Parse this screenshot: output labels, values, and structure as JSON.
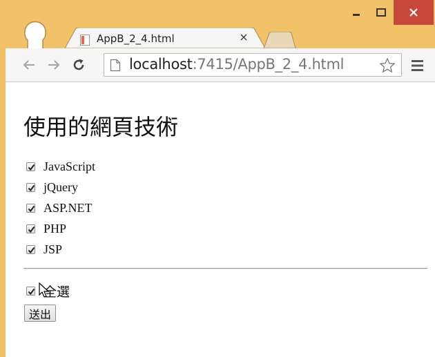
{
  "browser": {
    "tab": {
      "title": "AppB_2_4.html",
      "close_glyph": "×"
    },
    "window_controls": {
      "minimize": "minimize-icon",
      "maximize": "maximize-icon",
      "close": "close-icon"
    },
    "address": {
      "host": "localhost",
      "rest": ":7415/AppB_2_4.html"
    },
    "colors": {
      "frame": "#f2c268",
      "close_button": "#c7473a"
    }
  },
  "page": {
    "title": "使用的網頁技術",
    "options": [
      {
        "label": "JavaScript",
        "checked": true
      },
      {
        "label": "jQuery",
        "checked": true
      },
      {
        "label": "ASP.NET",
        "checked": true
      },
      {
        "label": "PHP",
        "checked": true
      },
      {
        "label": "JSP",
        "checked": true
      }
    ],
    "select_all": {
      "label": "全選",
      "checked": true
    },
    "submit_label": "送出"
  }
}
